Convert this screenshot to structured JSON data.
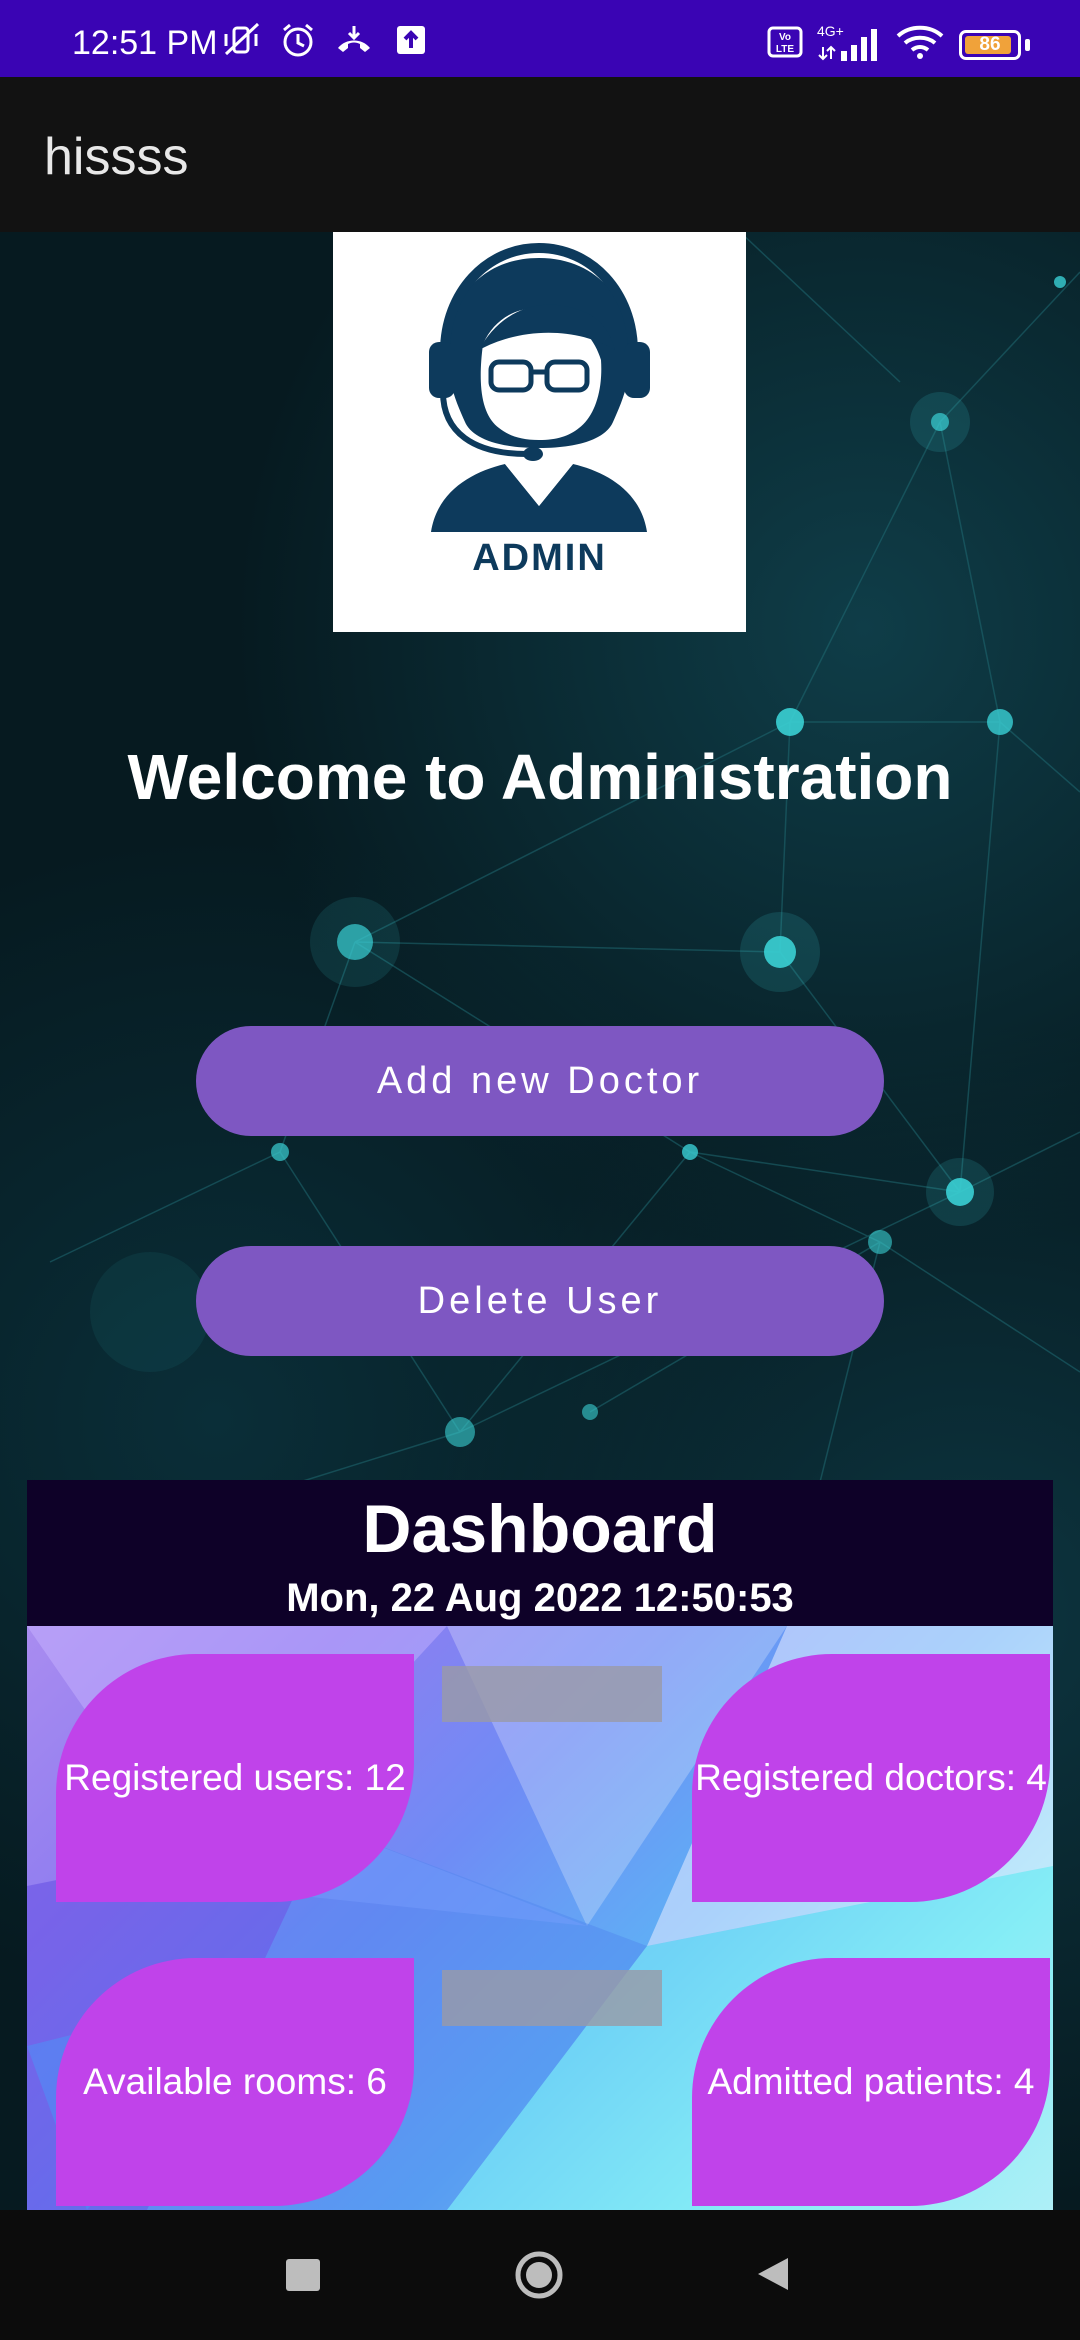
{
  "status_bar": {
    "time": "12:51 PM",
    "left_icons": [
      "mute-vibrate-icon",
      "alarm-icon",
      "call-forward-icon",
      "upload-icon"
    ],
    "right_icons": [
      "volte-icon",
      "signal-4g-icon",
      "wifi-icon"
    ],
    "network_label": "4G+",
    "volte_label": "Vo LTE",
    "battery_level": "86"
  },
  "app_bar": {
    "title": "hissss"
  },
  "admin_logo": {
    "label": "ADMIN"
  },
  "welcome": {
    "text": "Welcome to Administration"
  },
  "buttons": {
    "add_doctor": "Add new Doctor",
    "delete_user": "Delete User"
  },
  "dashboard": {
    "title": "Dashboard",
    "datetime": "Mon, 22 Aug 2022 12:50:53",
    "cards": [
      {
        "label": "Registered users: 12"
      },
      {
        "label": "Registered doctors: 4"
      },
      {
        "label": "Available rooms: 6"
      },
      {
        "label": "Admitted patients: 4"
      }
    ]
  },
  "nav_bar": {
    "icons": [
      "recents-icon",
      "home-icon",
      "back-icon"
    ]
  },
  "colors": {
    "status_bar": "#3a04b4",
    "app_bar": "#121212",
    "button": "#7e57c2",
    "card": "#c043ea",
    "dashboard_header": "#0e0128",
    "logo_navy": "#0d3a5c"
  }
}
